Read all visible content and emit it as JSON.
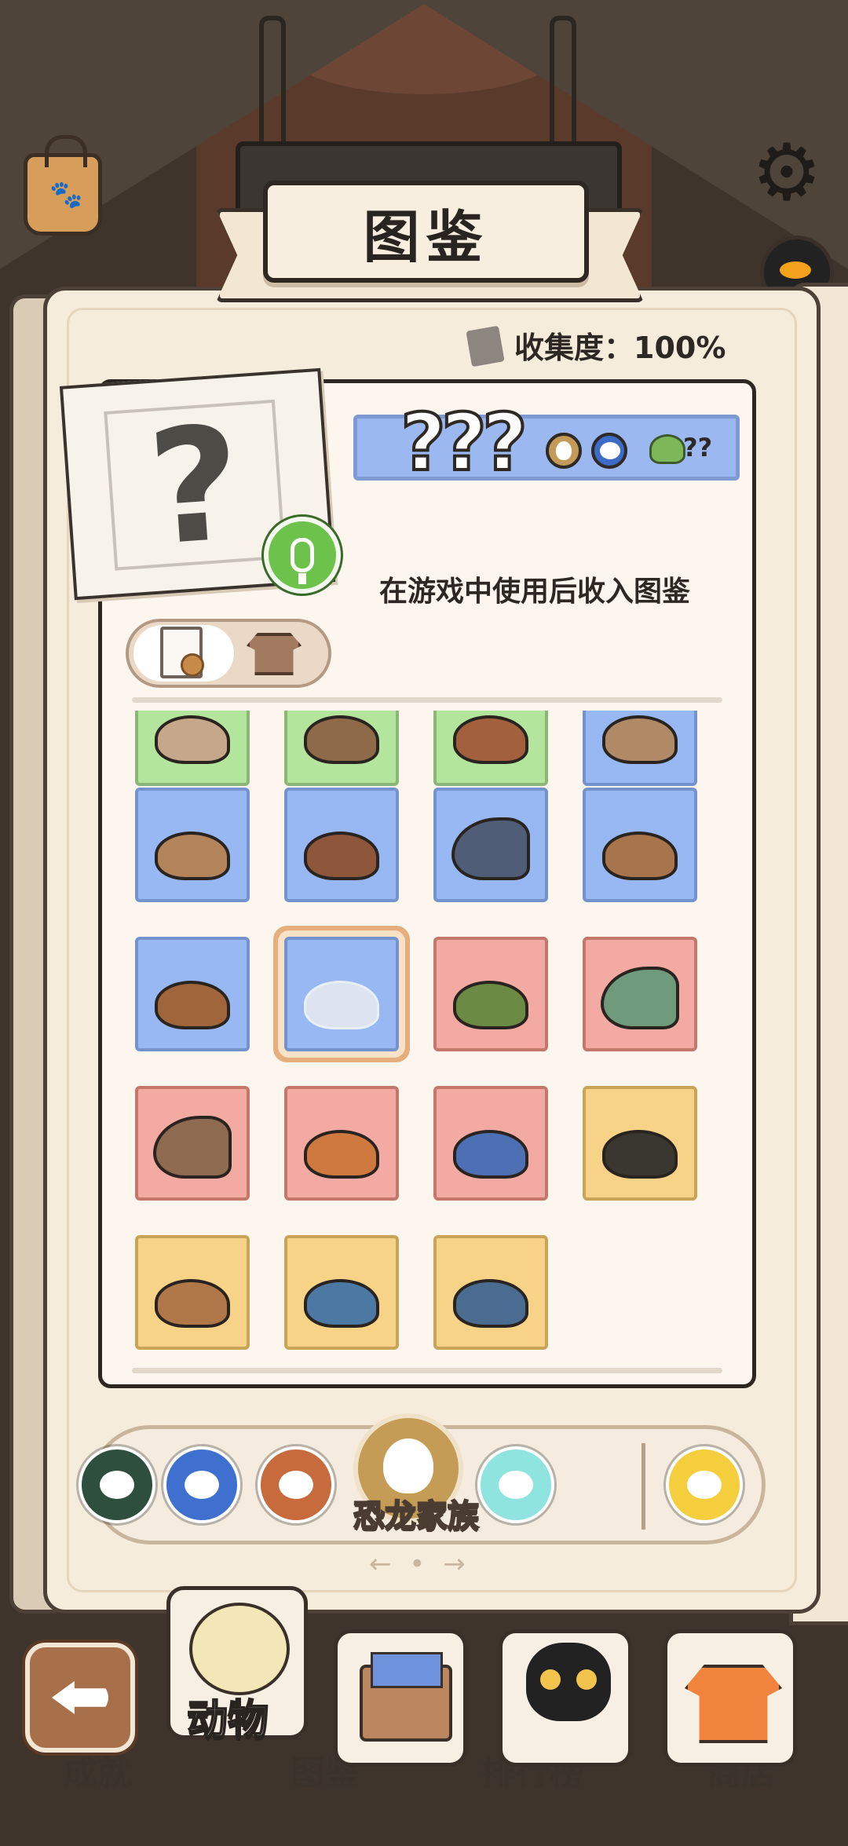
{
  "header": {
    "title": "图鉴"
  },
  "collection": {
    "label": "收集度：100%"
  },
  "detail": {
    "name": "???",
    "food_count": "??",
    "description": "在游戏中使用后收入图鉴",
    "photo_placeholder": "?"
  },
  "grid": {
    "rows": [
      [
        "green",
        "green",
        "green",
        "blue"
      ],
      [
        "blue",
        "blue",
        "blue",
        "blue"
      ],
      [
        "blue",
        "blue-selected-undiscovered",
        "red",
        "red"
      ],
      [
        "red",
        "red",
        "red",
        "yellow"
      ],
      [
        "yellow",
        "yellow",
        "yellow"
      ]
    ],
    "colors": {
      "green": "#b4e59d",
      "blue": "#97b8f2",
      "red": "#f2aaa2",
      "yellow": "#f6d387",
      "selected_ring": "#e5ae7c"
    }
  },
  "category_bar": {
    "selected_label": "恐龙家族",
    "icons": [
      "partial-blob-icon",
      "blue-blob-icon",
      "red-bird-icon",
      "dino-egg-icon",
      "cyan-blob-icon",
      "paw-icon"
    ]
  },
  "scroll_hint": "← • →",
  "bottom_nav": {
    "active_label": "动物",
    "under_labels": [
      "成就",
      "图鉴",
      "排行榜",
      "商店"
    ]
  }
}
